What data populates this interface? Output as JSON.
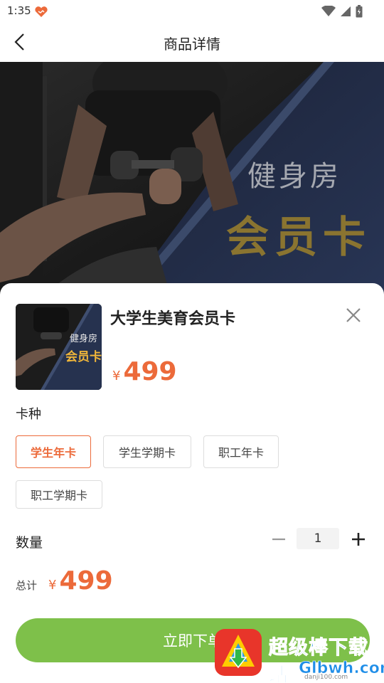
{
  "status_bar": {
    "time": "1:35"
  },
  "nav": {
    "title": "商品详情"
  },
  "banner": {
    "line1": "健身房",
    "line2": "会员卡"
  },
  "product": {
    "thumb_line1": "健身房",
    "thumb_line2": "会员卡",
    "name": "大学生美育会员卡",
    "currency": "¥",
    "price": "499"
  },
  "card_type": {
    "label": "卡种",
    "options": [
      "学生年卡",
      "学生学期卡",
      "职工年卡",
      "职工学期卡"
    ],
    "selected": "学生年卡"
  },
  "quantity": {
    "label": "数量",
    "value": "1"
  },
  "total": {
    "label": "总计",
    "currency": "¥",
    "amount": "499"
  },
  "buy_button": {
    "label": "立即下单"
  },
  "watermark": {
    "text": "超级棒下载站",
    "url": "Glbwh.com",
    "url_small": "danji100.com"
  },
  "colors": {
    "accent": "#ec6a3a",
    "button": "#7ec04a"
  },
  "icons": [
    "back-arrow-icon",
    "close-icon",
    "minus-icon",
    "plus-icon",
    "wifi-icon",
    "signal-icon",
    "battery-icon",
    "heart-icon"
  ]
}
